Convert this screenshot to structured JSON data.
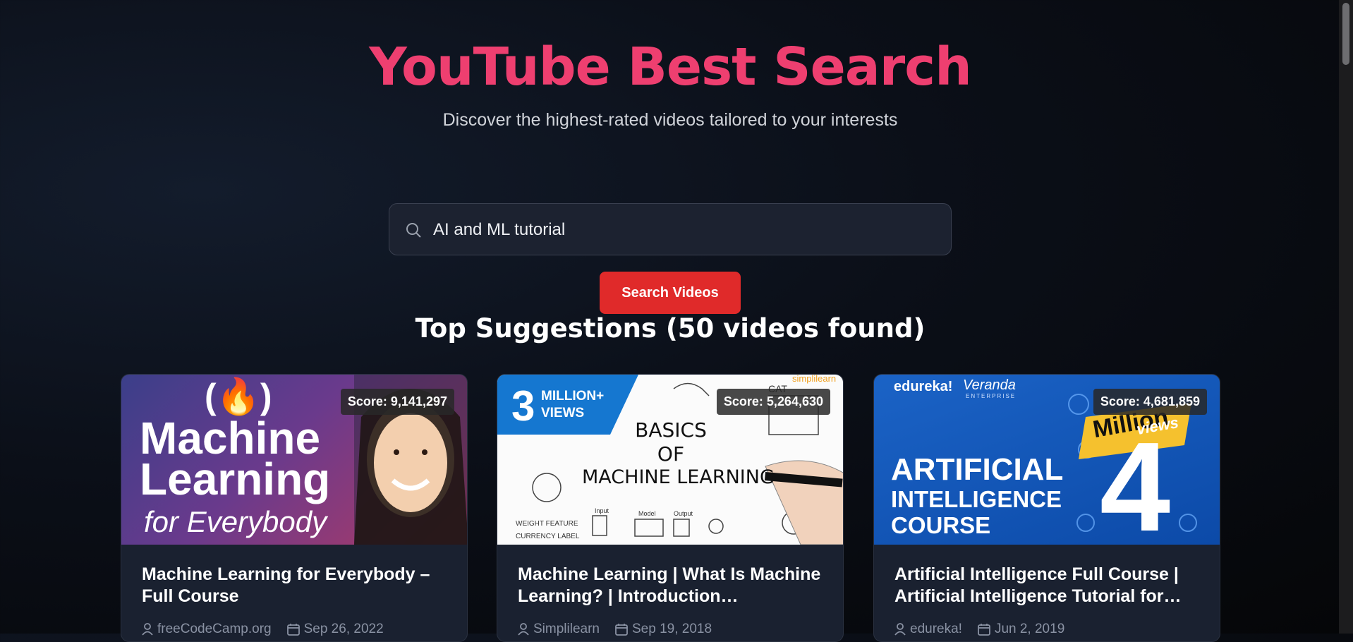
{
  "header": {
    "title": "YouTube Best Search",
    "subtitle": "Discover the highest-rated videos tailored to your interests"
  },
  "search": {
    "value": "AI and ML tutorial",
    "button_label": "Search Videos"
  },
  "results": {
    "heading": "Top Suggestions (50 videos found)"
  },
  "cards": [
    {
      "score": "Score: 9,141,297",
      "title": "Machine Learning for Everybody – Full Course",
      "channel": "freeCodeCamp.org",
      "date": "Sep 26, 2022",
      "thumb": {
        "line1": "Machine",
        "line2": "Learning",
        "line3": "for Everybody",
        "logo": "(🔥)"
      }
    },
    {
      "score": "Score: 5,264,630",
      "title": "Machine Learning | What Is Machine Learning? | Introduction…",
      "channel": "Simplilearn",
      "date": "Sep 19, 2018",
      "thumb": {
        "badge_num": "3",
        "badge_text1": "MILLION+",
        "badge_text2": "VIEWS",
        "line1": "BASICS",
        "line2": "OF",
        "line3": "MACHINE LEARNING",
        "brand": "simplilearn",
        "cat": "CAT",
        "weight": "WEIGHT FEATURE",
        "currency": "CURRENCY LABEL",
        "input": "Input",
        "model": "Model",
        "output": "Output"
      }
    },
    {
      "score": "Score: 4,681,859",
      "title": "Artificial Intelligence Full Course | Artificial Intelligence Tutorial for…",
      "channel": "edureka!",
      "date": "Jun 2, 2019",
      "thumb": {
        "brand1": "edureka!",
        "brand2": "Veranda",
        "brand3": "ENTERPRISE",
        "line1": "ARTIFICIAL",
        "line2": "INTELLIGENCE",
        "line3": "COURSE",
        "big_num": "4",
        "million": "Million",
        "views": "views"
      }
    }
  ],
  "colors": {
    "title": "#ee3f70",
    "button": "#e02a2a",
    "card_bg": "#1a2130"
  }
}
